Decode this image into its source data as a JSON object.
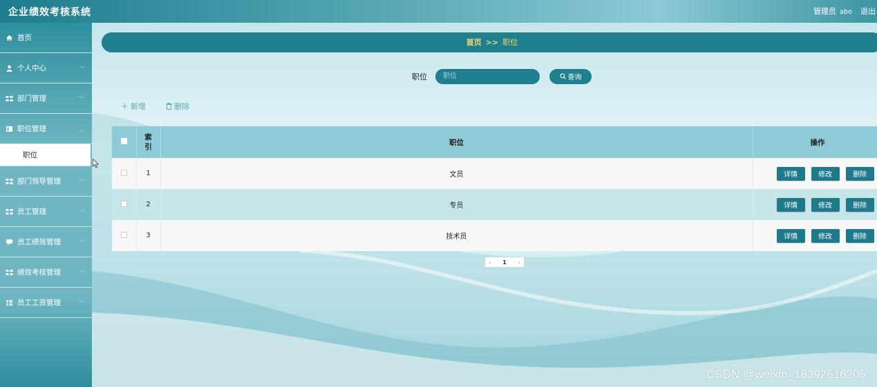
{
  "header": {
    "app_title": "企业绩效考核系统",
    "role": "管理员",
    "username": "abo",
    "logout": "退出"
  },
  "sidebar": {
    "items": [
      {
        "label": "首页",
        "icon": "home-icon"
      },
      {
        "label": "个人中心",
        "icon": "user-icon"
      },
      {
        "label": "部门管理",
        "icon": "grid-icon"
      },
      {
        "label": "职位管理",
        "icon": "book-icon"
      },
      {
        "label": "部门领导管理",
        "icon": "grid-icon"
      },
      {
        "label": "员工管理",
        "icon": "grid-icon"
      },
      {
        "label": "员工绩效管理",
        "icon": "chat-icon"
      },
      {
        "label": "绩效考核管理",
        "icon": "grid-icon"
      },
      {
        "label": "员工工资管理",
        "icon": "table-icon"
      }
    ],
    "active_subitem": "职位"
  },
  "breadcrumb": {
    "home": "首页",
    "separator": ">>",
    "current": "职位"
  },
  "search": {
    "label": "职位",
    "placeholder": "职位",
    "value": "",
    "button": "查询"
  },
  "actions": {
    "add": "新增",
    "delete": "删除"
  },
  "table": {
    "headers": {
      "index": "索\n引",
      "position": "职位",
      "operation": "操作"
    },
    "rows": [
      {
        "index": "1",
        "position": "文员"
      },
      {
        "index": "2",
        "position": "专员"
      },
      {
        "index": "3",
        "position": "技术员"
      }
    ],
    "row_buttons": {
      "detail": "详情",
      "edit": "修改",
      "delete": "删除"
    }
  },
  "pagination": {
    "prev": "‹",
    "page": "1",
    "next": "›"
  },
  "watermark": "CSDN @weixin_18392616205",
  "colors": {
    "primary": "#1f7f8f",
    "breadcrumb_text": "#f7d96a",
    "header_row": "#8ecbd6"
  }
}
